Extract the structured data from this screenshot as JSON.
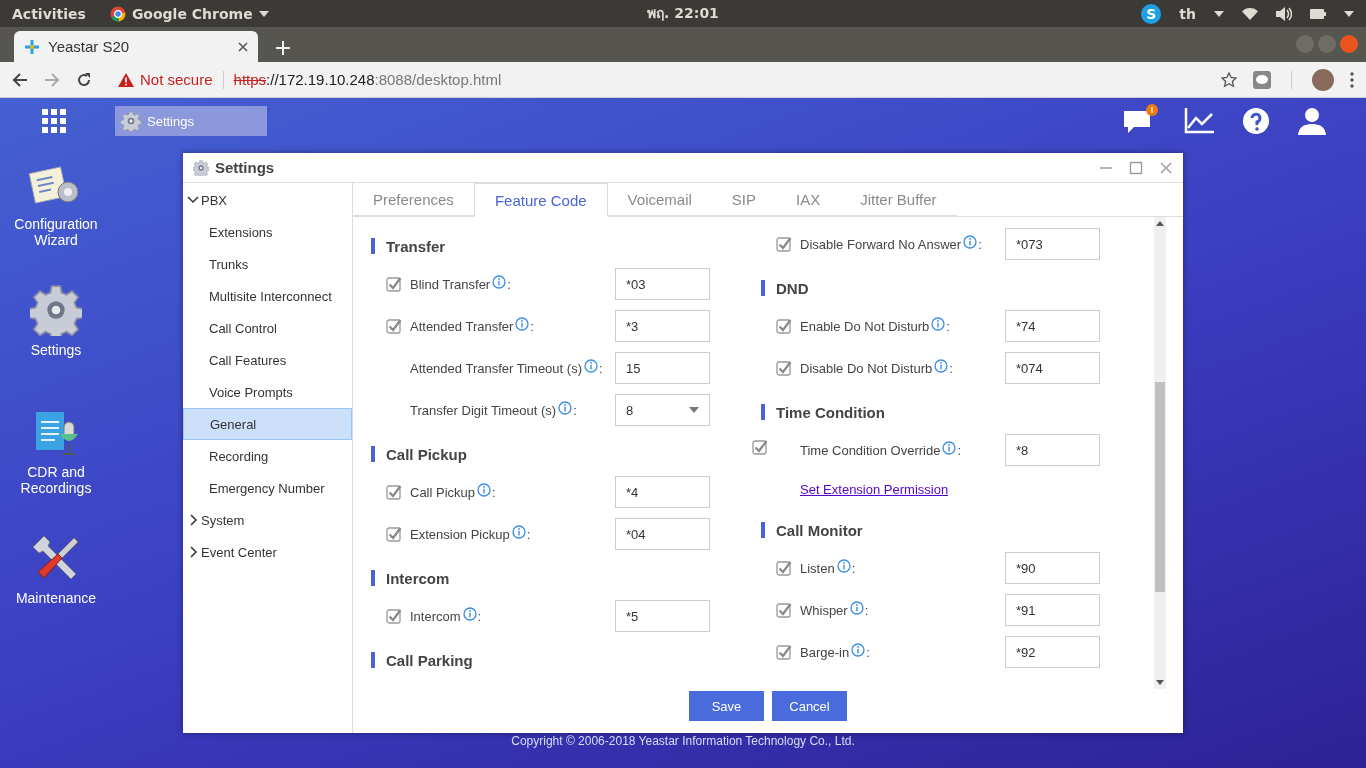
{
  "top_bar": {
    "activities": "Activities",
    "app_menu": "Google Chrome",
    "clock": "พฤ. 22:01",
    "tray_app_letter": "S",
    "keyboard_layout": "th"
  },
  "browser": {
    "tab_title": "Yeastar S20",
    "security": "Not secure",
    "url_scheme": "https",
    "url_host": "://172.19.10.248",
    "url_rest": ":8088/desktop.html"
  },
  "desktop": {
    "taskbar_items": [
      {
        "label": "Settings",
        "selected": true
      }
    ],
    "notification_alert": "!",
    "icons": [
      {
        "kind": "wizard",
        "label": "Configuration Wizard"
      },
      {
        "kind": "settings",
        "label": "Settings"
      },
      {
        "kind": "cdr",
        "label": "CDR and Recordings"
      },
      {
        "kind": "maintenance",
        "label": "Maintenance"
      }
    ],
    "copyright": "Copyright © 2006-2018 Yeastar Information Technology Co., Ltd."
  },
  "window": {
    "title": "Settings",
    "sidebar": {
      "items": [
        {
          "label": "PBX",
          "expanded": true,
          "children": [
            {
              "label": "Extensions",
              "selected": false
            },
            {
              "label": "Trunks",
              "selected": false
            },
            {
              "label": "Multisite Interconnect",
              "selected": false
            },
            {
              "label": "Call Control",
              "selected": false
            },
            {
              "label": "Call Features",
              "selected": false
            },
            {
              "label": "Voice Prompts",
              "selected": false
            },
            {
              "label": "General",
              "selected": true
            },
            {
              "label": "Recording",
              "selected": false
            },
            {
              "label": "Emergency Number",
              "selected": false
            }
          ]
        },
        {
          "label": "System",
          "expanded": false
        },
        {
          "label": "Event Center",
          "expanded": false
        }
      ]
    },
    "tabs": [
      {
        "label": "Preferences",
        "selected": false
      },
      {
        "label": "Feature Code",
        "selected": true
      },
      {
        "label": "Voicemail",
        "selected": false
      },
      {
        "label": "SIP",
        "selected": false
      },
      {
        "label": "IAX",
        "selected": false
      },
      {
        "label": "Jitter Buffer",
        "selected": false
      }
    ],
    "label_separator": ":",
    "columns": [
      [
        {
          "title": "Transfer",
          "items": [
            {
              "kind": "check",
              "checked": true,
              "label": "Blind Transfer",
              "value": "*03"
            },
            {
              "kind": "check",
              "checked": true,
              "label": "Attended Transfer",
              "value": "*3"
            },
            {
              "kind": "plain",
              "label": "Attended Transfer Timeout (s)",
              "value": "15"
            },
            {
              "kind": "select",
              "label": "Transfer Digit Timeout (s)",
              "value": "8"
            }
          ]
        },
        {
          "title": "Call Pickup",
          "items": [
            {
              "kind": "check",
              "checked": true,
              "label": "Call Pickup",
              "value": "*4"
            },
            {
              "kind": "check",
              "checked": true,
              "label": "Extension Pickup",
              "value": "*04"
            }
          ]
        },
        {
          "title": "Intercom",
          "items": [
            {
              "kind": "check",
              "checked": true,
              "label": "Intercom",
              "value": "*5"
            }
          ]
        },
        {
          "title": "Call Parking"
        }
      ],
      [
        {
          "items": [
            {
              "kind": "check",
              "checked": true,
              "label": "Disable Forward No Answer",
              "value": "*073"
            }
          ]
        },
        {
          "title": "DND",
          "items": [
            {
              "kind": "check",
              "checked": true,
              "label": "Enable Do Not Disturb",
              "value": "*74"
            },
            {
              "kind": "check",
              "checked": true,
              "label": "Disable Do Not Disturb",
              "value": "*074"
            }
          ]
        },
        {
          "title": "Time Condition",
          "items": [
            {
              "kind": "outdent",
              "checked": true,
              "label": "Time Condition Override",
              "value": "*8"
            },
            {
              "kind": "link",
              "label": "Set Extension Permission"
            }
          ]
        },
        {
          "title": "Call Monitor",
          "items": [
            {
              "kind": "check",
              "checked": true,
              "label": "Listen",
              "value": "*90"
            },
            {
              "kind": "check",
              "checked": true,
              "label": "Whisper",
              "value": "*91"
            },
            {
              "kind": "check",
              "checked": true,
              "label": "Barge-in",
              "value": "*92"
            }
          ]
        }
      ]
    ],
    "buttons": [
      "Save",
      "Cancel"
    ]
  }
}
